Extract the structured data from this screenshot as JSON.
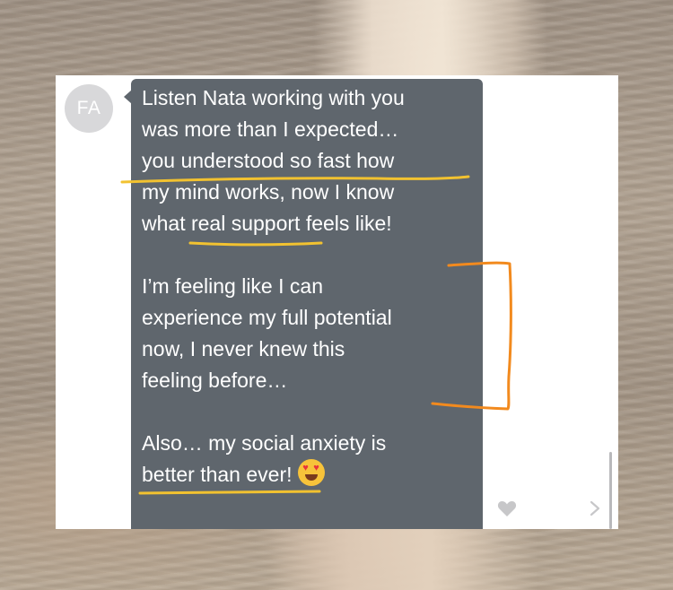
{
  "avatar": {
    "initials": "FA"
  },
  "message": {
    "paragraph_1": "Listen Nata working with you\nwas more than I expected…\nyou understood so fast how\nmy mind works, now I know\nwhat real support feels like!",
    "paragraph_2": "I’m feeling like I can\nexperience my full potential\nnow, I never knew this\nfeeling before…",
    "paragraph_3": "Also… my social anxiety is\nbetter than ever!",
    "emoji": "heart-eyes-emoji"
  },
  "actions": {
    "like_icon": "heart-icon",
    "next_icon": "chevron-right-icon"
  },
  "colors": {
    "bubble": "#5f666d",
    "avatar": "#d8d8da",
    "highlight_yellow": "#f2c230",
    "bracket_orange": "#f28a1e"
  }
}
